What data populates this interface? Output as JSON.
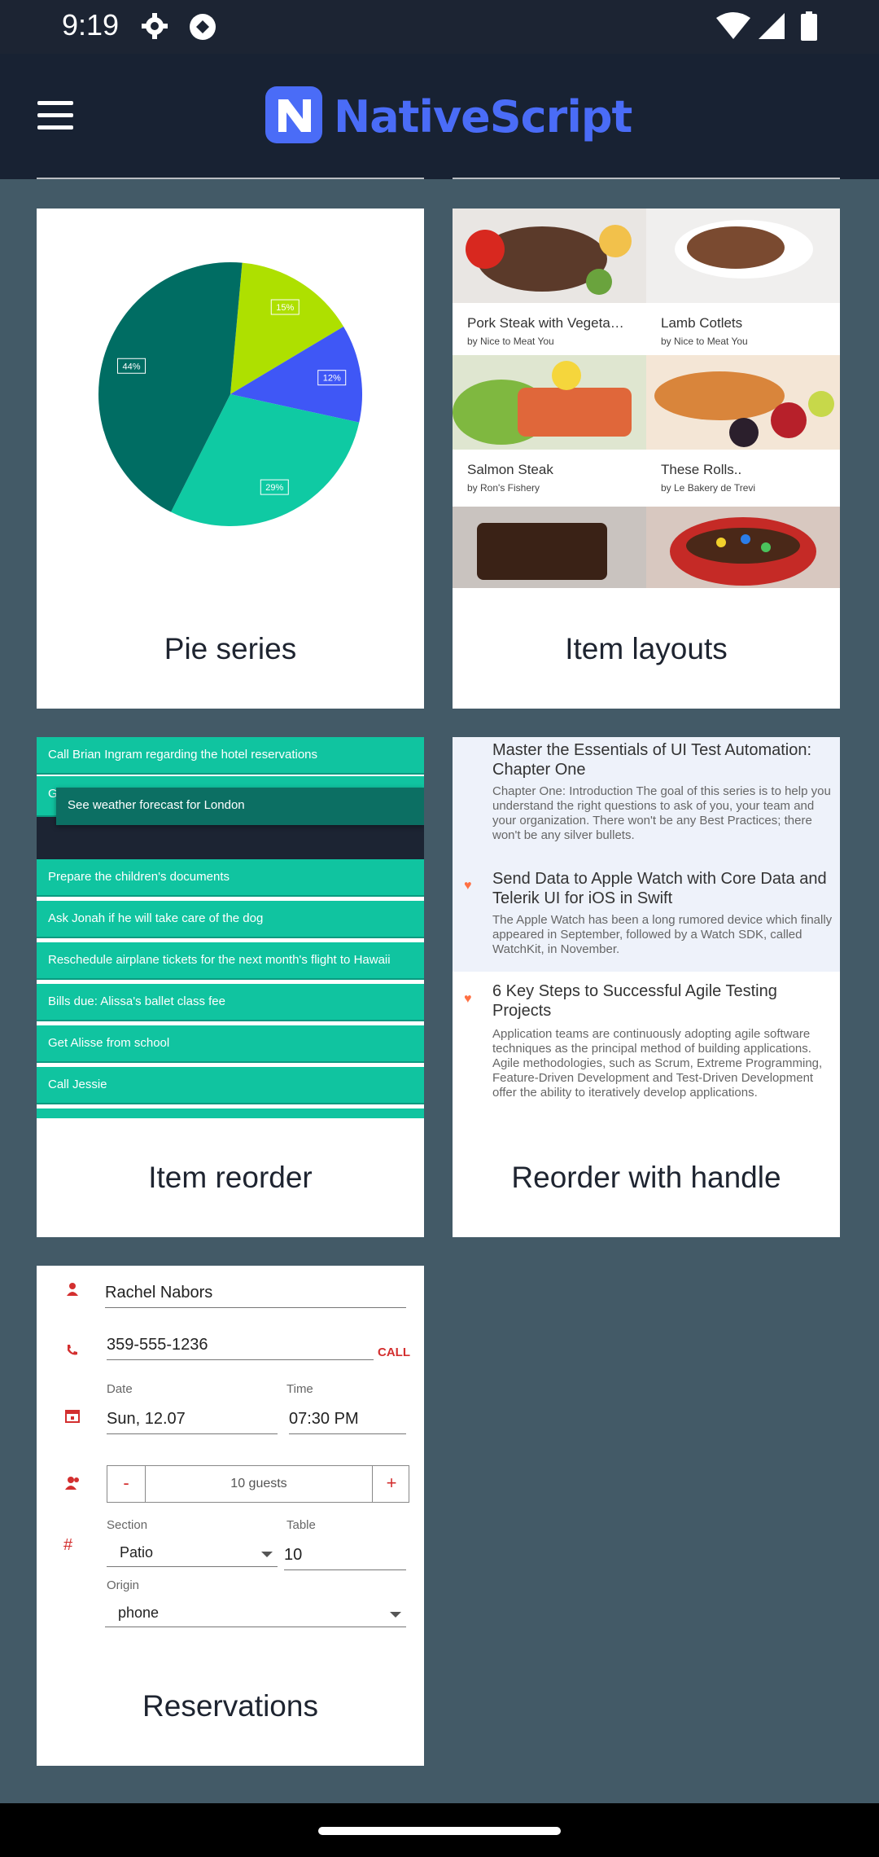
{
  "status_bar": {
    "time": "9:19",
    "icons": [
      "gear-icon",
      "sync-icon",
      "wifi-icon",
      "signal-icon",
      "battery-icon"
    ]
  },
  "app_bar": {
    "logo_letter": "N",
    "logo_text": "NativeScript",
    "menu_icon": "hamburger-menu-icon",
    "accent": "#4a6cf7"
  },
  "cards": {
    "pie": {
      "label": "Pie series",
      "chart_data": {
        "type": "pie",
        "values": [
          15,
          12,
          29,
          44
        ],
        "labels": [
          "15%",
          "12%",
          "29%",
          "44%"
        ],
        "colors": [
          "#aee000",
          "#3f57f6",
          "#0fcaa3",
          "#006d63"
        ]
      }
    },
    "layouts": {
      "label": "Item layouts",
      "items": [
        {
          "title": "Pork Steak with Vegetables",
          "sub": "by Nice to Meat You"
        },
        {
          "title": "Lamb Cotlets",
          "sub": "by Nice to Meat You"
        },
        {
          "title": "Salmon Steak",
          "sub": "by Ron's Fishery"
        },
        {
          "title": "These Rolls..",
          "sub": "by Le Bakery de Trevi"
        }
      ]
    },
    "reorder": {
      "label": "Item reorder",
      "rows": [
        "Call Brian Ingram regarding the hotel reservations",
        "G",
        "See weather forecast for London",
        "Prepare the children's documents",
        "Ask Jonah if he will take care of the dog",
        "Reschedule airplane tickets for the next month's flight to Hawaii",
        "Bills due: Alissa's ballet class fee",
        "Get Alisse from school",
        "Call Jessie"
      ]
    },
    "handle": {
      "label": "Reorder with handle",
      "items": [
        {
          "title": "Master the Essentials of UI Test Automation: Chapter One",
          "body": "Chapter One: Introduction The goal of this series is to help you understand the right questions to ask of you, your team and your organization. There won't be any Best Practices; there won't be any silver bullets."
        },
        {
          "title": "Send Data to Apple Watch with Core Data and Telerik UI for iOS in Swift",
          "body": "The Apple Watch has been a long rumored device which finally appeared in September, followed by a Watch SDK, called WatchKit, in November."
        },
        {
          "title": "6 Key Steps to Successful Agile Testing Projects",
          "body": "Application teams are continuously adopting agile software techniques as the principal method of building applications. Agile methodologies, such as Scrum, Extreme Programming, Feature-Driven Development and Test-Driven Development offer the ability to iteratively develop applications."
        }
      ]
    },
    "reservations": {
      "label": "Reservations",
      "name": "Rachel Nabors",
      "phone": "359-555-1236",
      "call": "CALL",
      "date_caption": "Date",
      "date": "Sun, 12.07",
      "time_caption": "Time",
      "time": "07:30 PM",
      "minus": "-",
      "guests": "10 guests",
      "plus": "+",
      "section_caption": "Section",
      "section": "Patio",
      "table_caption": "Table",
      "table": "10",
      "origin_caption": "Origin",
      "origin": "phone",
      "hash": "#"
    }
  }
}
